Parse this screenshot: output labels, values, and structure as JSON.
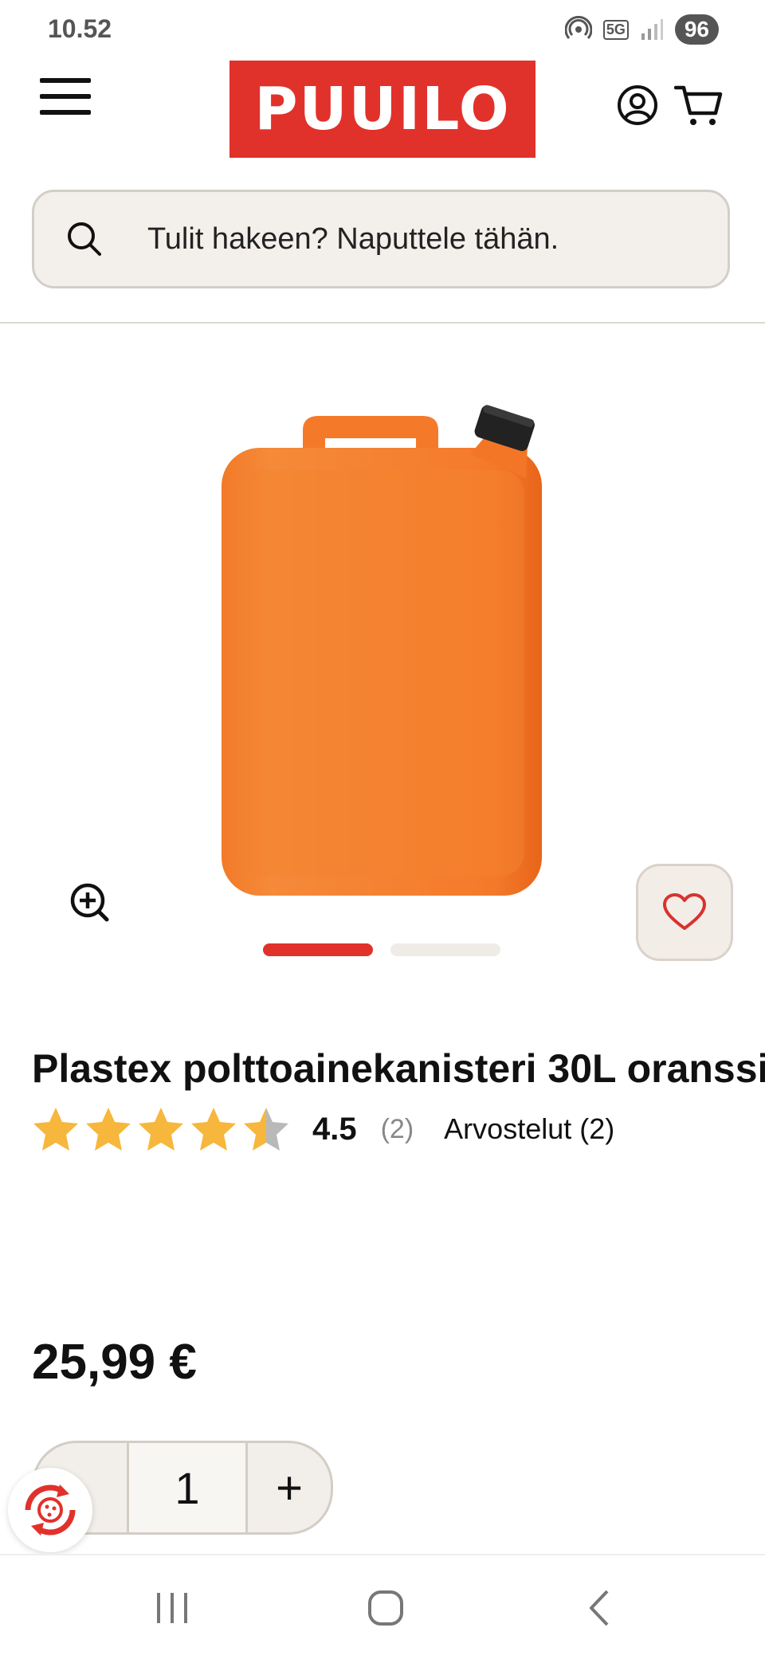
{
  "status_bar": {
    "time": "10.52",
    "network": "5G",
    "battery": "96"
  },
  "header": {
    "logo_text": "PUUILO"
  },
  "search": {
    "placeholder": "Tulit hakeen? Naputtele tähän."
  },
  "product": {
    "title": "Plastex polttoainekanisteri 30L oranssi",
    "rating_value": "4.5",
    "rating": 4.5,
    "rating_max": 5,
    "rating_count": "(2)",
    "reviews_link": "Arvostelut (2)",
    "price": "25,99 €",
    "image_count": 2,
    "active_image": 1
  },
  "quantity": {
    "minus": "-",
    "value": "1",
    "plus": "+"
  },
  "colors": {
    "brand": "#e1312b",
    "canister": "#f57c2a",
    "star": "#f6b73c"
  },
  "icons": {
    "menu": "hamburger-menu-icon",
    "account": "user-circle-icon",
    "cart": "shopping-cart-icon",
    "search": "search-icon",
    "zoom": "zoom-in-icon",
    "wishlist": "heart-icon",
    "cookie": "cookie-settings-icon"
  }
}
